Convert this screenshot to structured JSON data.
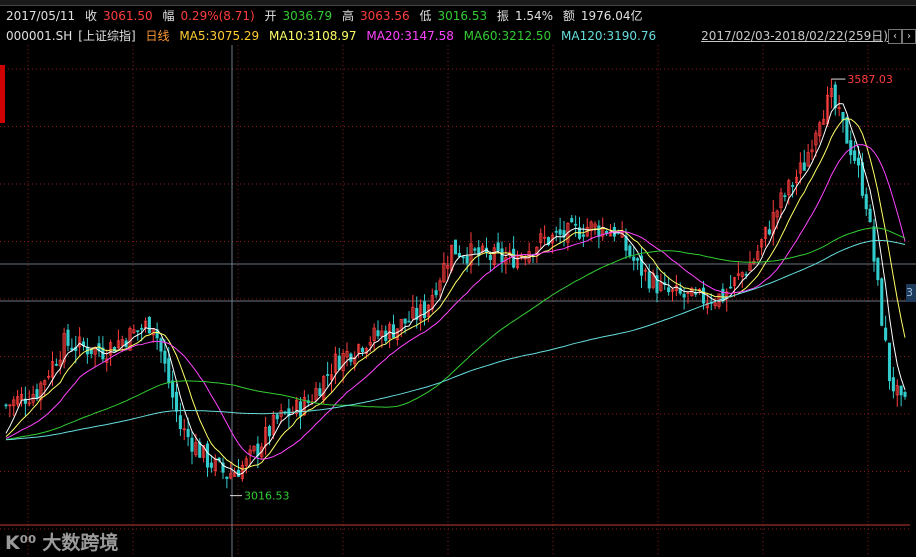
{
  "info_bar": {
    "date": "2017/05/11",
    "close_label": "收",
    "close_value": "3061.50",
    "change_label": "幅",
    "change_value": "0.29%(8.71)",
    "open_label": "开",
    "open_value": "3036.79",
    "high_label": "高",
    "high_value": "3063.56",
    "low_label": "低",
    "low_value": "3016.53",
    "amplitude_label": "振",
    "amplitude_value": "1.54%",
    "amount_label": "额",
    "amount_value": "1976.04亿"
  },
  "ma_bar": {
    "symbol": "000001.SH",
    "name": "[上证综指]",
    "period": "日线",
    "ma5": "MA5:3075.29",
    "ma10": "MA10:3108.97",
    "ma20": "MA20:3147.58",
    "ma60": "MA60:3212.50",
    "ma120": "MA120:3190.76",
    "range": "2017/02/03-2018/02/22(259日)",
    "prev_icon": "chevron-left-icon",
    "next_icon": "chevron-right-icon",
    "prev_glyph": "‹",
    "next_glyph": "›"
  },
  "right_tag": "3",
  "logo": {
    "mark": "K⁰⁰",
    "text": "大数跨境"
  },
  "colors": {
    "up": "#ff3d3d",
    "down": "#33cccc",
    "ma5": "#ffffff",
    "ma10": "#ffff66",
    "ma20": "#ff44ff",
    "ma60": "#33cc33",
    "ma120": "#66dddd",
    "grid": "#8a1a1a"
  },
  "chart_data": {
    "type": "candlestick",
    "title": "",
    "y_axis_unit": "index points",
    "x_range": [
      "2017/02/03",
      "2018/02/22"
    ],
    "trading_days": 259,
    "annotations": [
      {
        "label": "3587.03",
        "kind": "period_high"
      },
      {
        "label": "3016.53",
        "kind": "period_low"
      }
    ],
    "ylim": [
      2990,
      3620
    ],
    "price_path": [
      {
        "day": 0,
        "close": 3140
      },
      {
        "day": 8,
        "close": 3160
      },
      {
        "day": 15,
        "close": 3225
      },
      {
        "day": 25,
        "close": 3215
      },
      {
        "day": 33,
        "close": 3240
      },
      {
        "day": 38,
        "close": 3255
      },
      {
        "day": 45,
        "close": 3110
      },
      {
        "day": 52,
        "close": 3065
      },
      {
        "day": 57,
        "close": 3045
      },
      {
        "day": 62,
        "close": 3060
      },
      {
        "day": 70,
        "close": 3120
      },
      {
        "day": 78,
        "close": 3145
      },
      {
        "day": 85,
        "close": 3200
      },
      {
        "day": 93,
        "close": 3230
      },
      {
        "day": 100,
        "close": 3245
      },
      {
        "day": 108,
        "close": 3270
      },
      {
        "day": 115,
        "close": 3355
      },
      {
        "day": 122,
        "close": 3345
      },
      {
        "day": 130,
        "close": 3340
      },
      {
        "day": 138,
        "close": 3365
      },
      {
        "day": 145,
        "close": 3375
      },
      {
        "day": 150,
        "close": 3385
      },
      {
        "day": 157,
        "close": 3380
      },
      {
        "day": 163,
        "close": 3330
      },
      {
        "day": 170,
        "close": 3295
      },
      {
        "day": 178,
        "close": 3285
      },
      {
        "day": 185,
        "close": 3290
      },
      {
        "day": 193,
        "close": 3340
      },
      {
        "day": 200,
        "close": 3420
      },
      {
        "day": 206,
        "close": 3470
      },
      {
        "day": 210,
        "close": 3540
      },
      {
        "day": 213,
        "close": 3560
      },
      {
        "day": 216,
        "close": 3520
      },
      {
        "day": 219,
        "close": 3480
      },
      {
        "day": 222,
        "close": 3420
      },
      {
        "day": 225,
        "close": 3300
      },
      {
        "day": 228,
        "close": 3180
      },
      {
        "day": 231,
        "close": 3140
      }
    ],
    "ma_latest": {
      "MA5": 3075.29,
      "MA10": 3108.97,
      "MA20": 3147.58,
      "MA60": 3212.5,
      "MA120": 3190.76
    }
  }
}
